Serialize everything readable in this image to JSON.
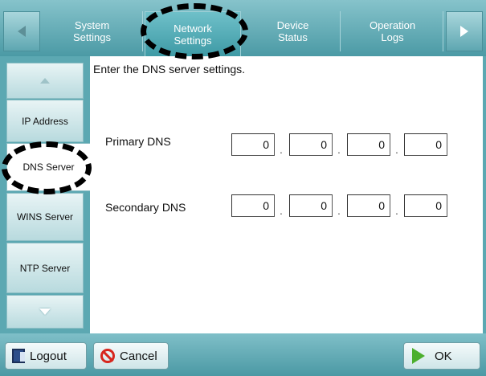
{
  "colors": {
    "accent": "#5ca8b2",
    "highlight_mark": "#000000",
    "ok_green": "#4caf2e",
    "cancel_red": "#d7261e"
  },
  "topbar": {
    "prev_icon": "triangle-left-icon",
    "next_icon": "triangle-right-icon",
    "tabs": [
      {
        "label": "System\nSettings",
        "selected": false
      },
      {
        "label": "Network\nSettings",
        "selected": true
      },
      {
        "label": "Device\nStatus",
        "selected": false
      },
      {
        "label": "Operation\nLogs",
        "selected": false
      }
    ]
  },
  "sidebar": {
    "scroll_up_icon": "triangle-up-icon",
    "scroll_down_icon": "triangle-down-icon",
    "items": [
      {
        "label": "IP Address",
        "active": false
      },
      {
        "label": "DNS Server",
        "active": true
      },
      {
        "label": "WINS Server",
        "active": false
      },
      {
        "label": "NTP Server",
        "active": false
      }
    ]
  },
  "main": {
    "instruction": "Enter the DNS server settings.",
    "primary": {
      "label": "Primary DNS",
      "octets": [
        "0",
        "0",
        "0",
        "0"
      ]
    },
    "secondary": {
      "label": "Secondary DNS",
      "octets": [
        "0",
        "0",
        "0",
        "0"
      ]
    },
    "separator": "."
  },
  "bottombar": {
    "logout_label": "Logout",
    "cancel_label": "Cancel",
    "ok_label": "OK"
  }
}
